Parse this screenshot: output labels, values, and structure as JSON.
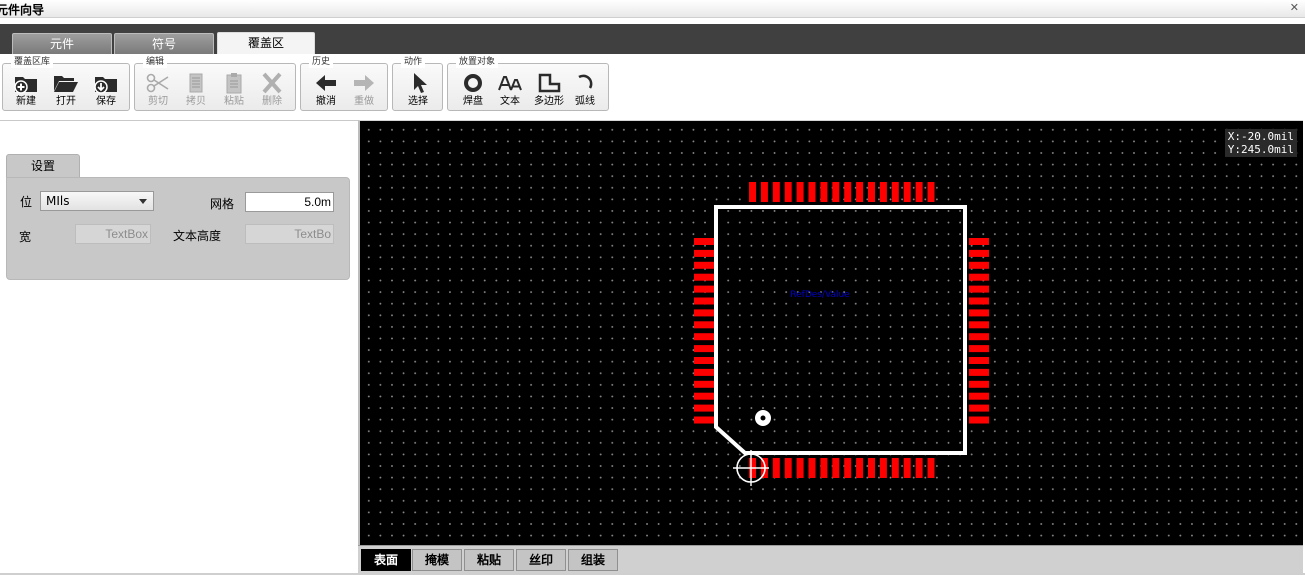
{
  "window": {
    "title": "元件向导",
    "close_glyph": "✕"
  },
  "tabs": [
    {
      "label": "元件",
      "active": false
    },
    {
      "label": "符号",
      "active": false
    },
    {
      "label": "覆盖区",
      "active": true
    }
  ],
  "ribbon": {
    "groups": [
      {
        "title": "覆盖区库",
        "buttons": [
          {
            "label": "新建",
            "icon": "new-folder-icon",
            "enabled": true
          },
          {
            "label": "打开",
            "icon": "open-folder-icon",
            "enabled": true
          },
          {
            "label": "保存",
            "icon": "save-folder-icon",
            "enabled": true
          }
        ]
      },
      {
        "title": "编辑",
        "buttons": [
          {
            "label": "剪切",
            "icon": "scissors-icon",
            "enabled": false
          },
          {
            "label": "拷贝",
            "icon": "copy-icon",
            "enabled": false
          },
          {
            "label": "粘贴",
            "icon": "paste-icon",
            "enabled": false
          },
          {
            "label": "删除",
            "icon": "delete-x-icon",
            "enabled": false
          }
        ]
      },
      {
        "title": "历史",
        "buttons": [
          {
            "label": "撤消",
            "icon": "undo-arrow-icon",
            "enabled": true
          },
          {
            "label": "重做",
            "icon": "redo-arrow-icon",
            "enabled": false
          }
        ]
      },
      {
        "title": "动作",
        "buttons": [
          {
            "label": "选择",
            "icon": "cursor-icon",
            "enabled": true
          }
        ]
      },
      {
        "title": "放置对象",
        "buttons": [
          {
            "label": "焊盘",
            "icon": "pad-circle-icon",
            "enabled": true
          },
          {
            "label": "文本",
            "icon": "text-aa-icon",
            "enabled": true
          },
          {
            "label": "多边形",
            "icon": "polygon-icon",
            "enabled": true
          },
          {
            "label": "弧线",
            "icon": "arc-icon",
            "enabled": true
          }
        ]
      }
    ]
  },
  "settings": {
    "tab_label": "设置",
    "unit_label_partial": "位",
    "unit_value": "MIls",
    "grid_label": "网格",
    "grid_value": "5.0m",
    "row2_label_partial": "宽",
    "textbox_left": "TextBox",
    "text_height_label": "文本高度",
    "textbox_right": "TextBo"
  },
  "canvas": {
    "coord_x": "X:-20.0mil",
    "coord_y": "Y:245.0mil",
    "refdes_text": "RefDes/Value",
    "pad_count_per_side": 16,
    "colors": {
      "background": "#000000",
      "pad": "#ff0000",
      "outline": "#ffffff",
      "text": "#0000cc"
    }
  },
  "layers": [
    {
      "label": "表面",
      "active": true
    },
    {
      "label": "掩模",
      "active": false
    },
    {
      "label": "粘贴",
      "active": false
    },
    {
      "label": "丝印",
      "active": false
    },
    {
      "label": "组装",
      "active": false
    }
  ]
}
